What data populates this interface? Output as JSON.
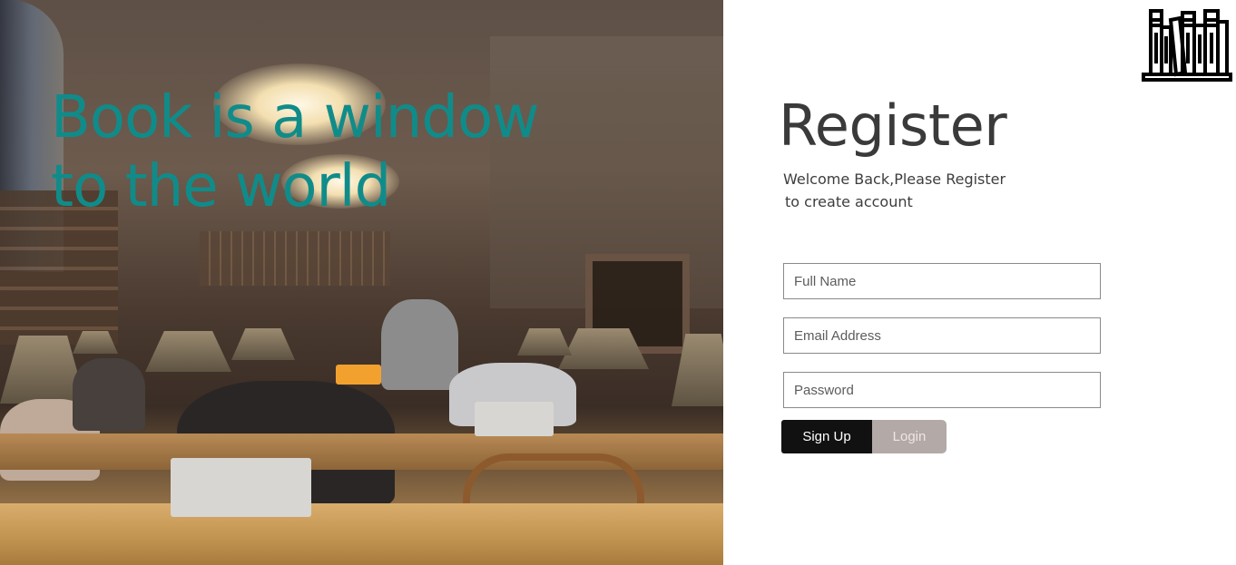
{
  "hero": {
    "headline_line1": "Book is a window",
    "headline_line2": "to the world"
  },
  "logo": {
    "icon": "books-icon"
  },
  "register": {
    "title": "Register",
    "subtitle_line1": "Welcome Back,Please Register",
    "subtitle_line2": "to create account"
  },
  "form": {
    "full_name_placeholder": "Full Name",
    "email_placeholder": "Email Address",
    "password_placeholder": "Password",
    "full_name_value": "",
    "email_value": "",
    "password_value": ""
  },
  "buttons": {
    "signup_label": "Sign Up",
    "login_label": "Login"
  },
  "colors": {
    "accent": "#0f8c8a",
    "primary_button": "#111111",
    "secondary_button": "#b3aaa8"
  }
}
